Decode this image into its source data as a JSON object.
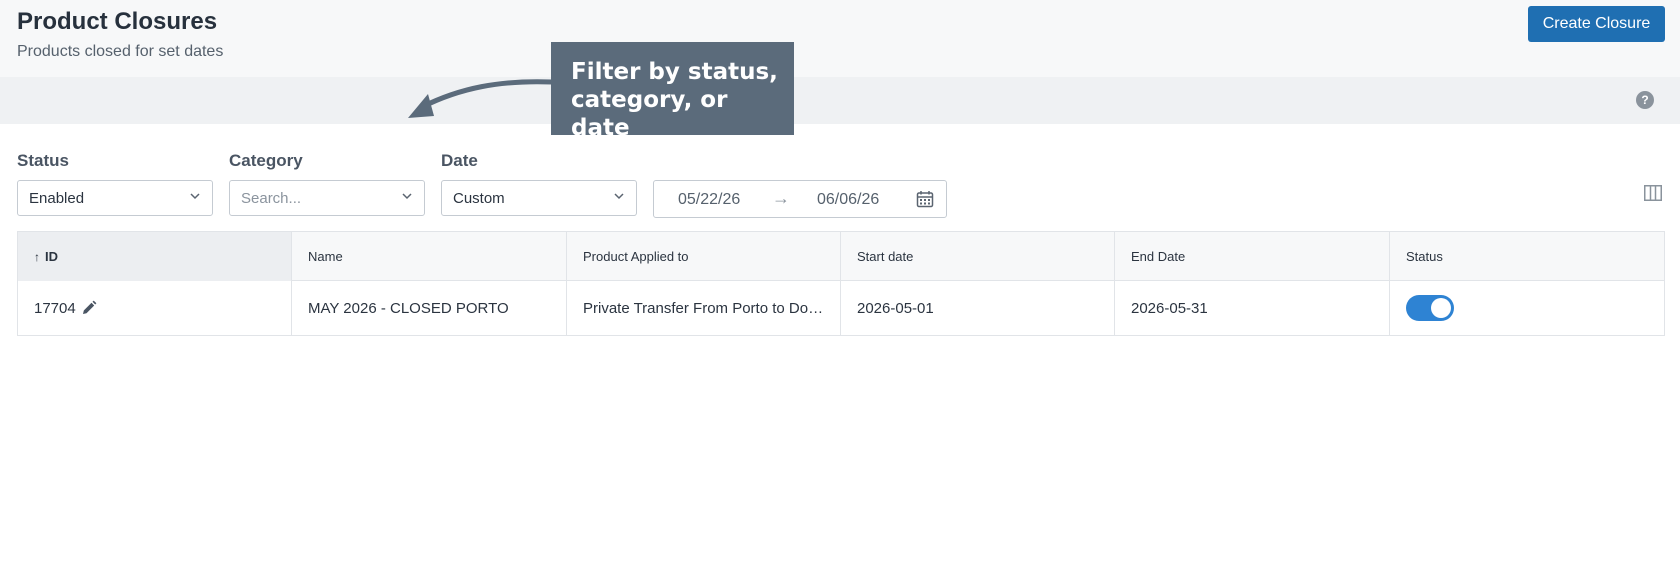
{
  "header": {
    "title": "Product Closures",
    "subtitle": "Products closed for set dates",
    "create_button": "Create Closure"
  },
  "callout": {
    "text": "Filter by status, category, or date"
  },
  "filters": {
    "status": {
      "label": "Status",
      "value": "Enabled"
    },
    "category": {
      "label": "Category",
      "placeholder": "Search..."
    },
    "date": {
      "label": "Date",
      "value": "Custom"
    },
    "date_range": {
      "from": "05/22/26",
      "separator": "→",
      "to": "06/06/26"
    }
  },
  "table": {
    "columns": [
      "ID",
      "Name",
      "Product Applied to",
      "Start date",
      "End Date",
      "Status"
    ],
    "sort_indicator": "↑",
    "rows": [
      {
        "id": "17704",
        "name": "MAY 2026 - CLOSED PORTO",
        "product": "Private Transfer From Porto to Douro Valley",
        "start": "2026-05-01",
        "end": "2026-05-31",
        "status_enabled": true
      }
    ]
  },
  "icons": {
    "help": "help-icon",
    "calendar": "calendar-icon",
    "columns": "columns-icon",
    "edit": "pencil-icon",
    "chevron": "chevron-down-icon"
  },
  "colors": {
    "primary": "#1f6fb2",
    "toggle_on": "#2e83d3",
    "callout_bg": "#5b6b7b"
  }
}
